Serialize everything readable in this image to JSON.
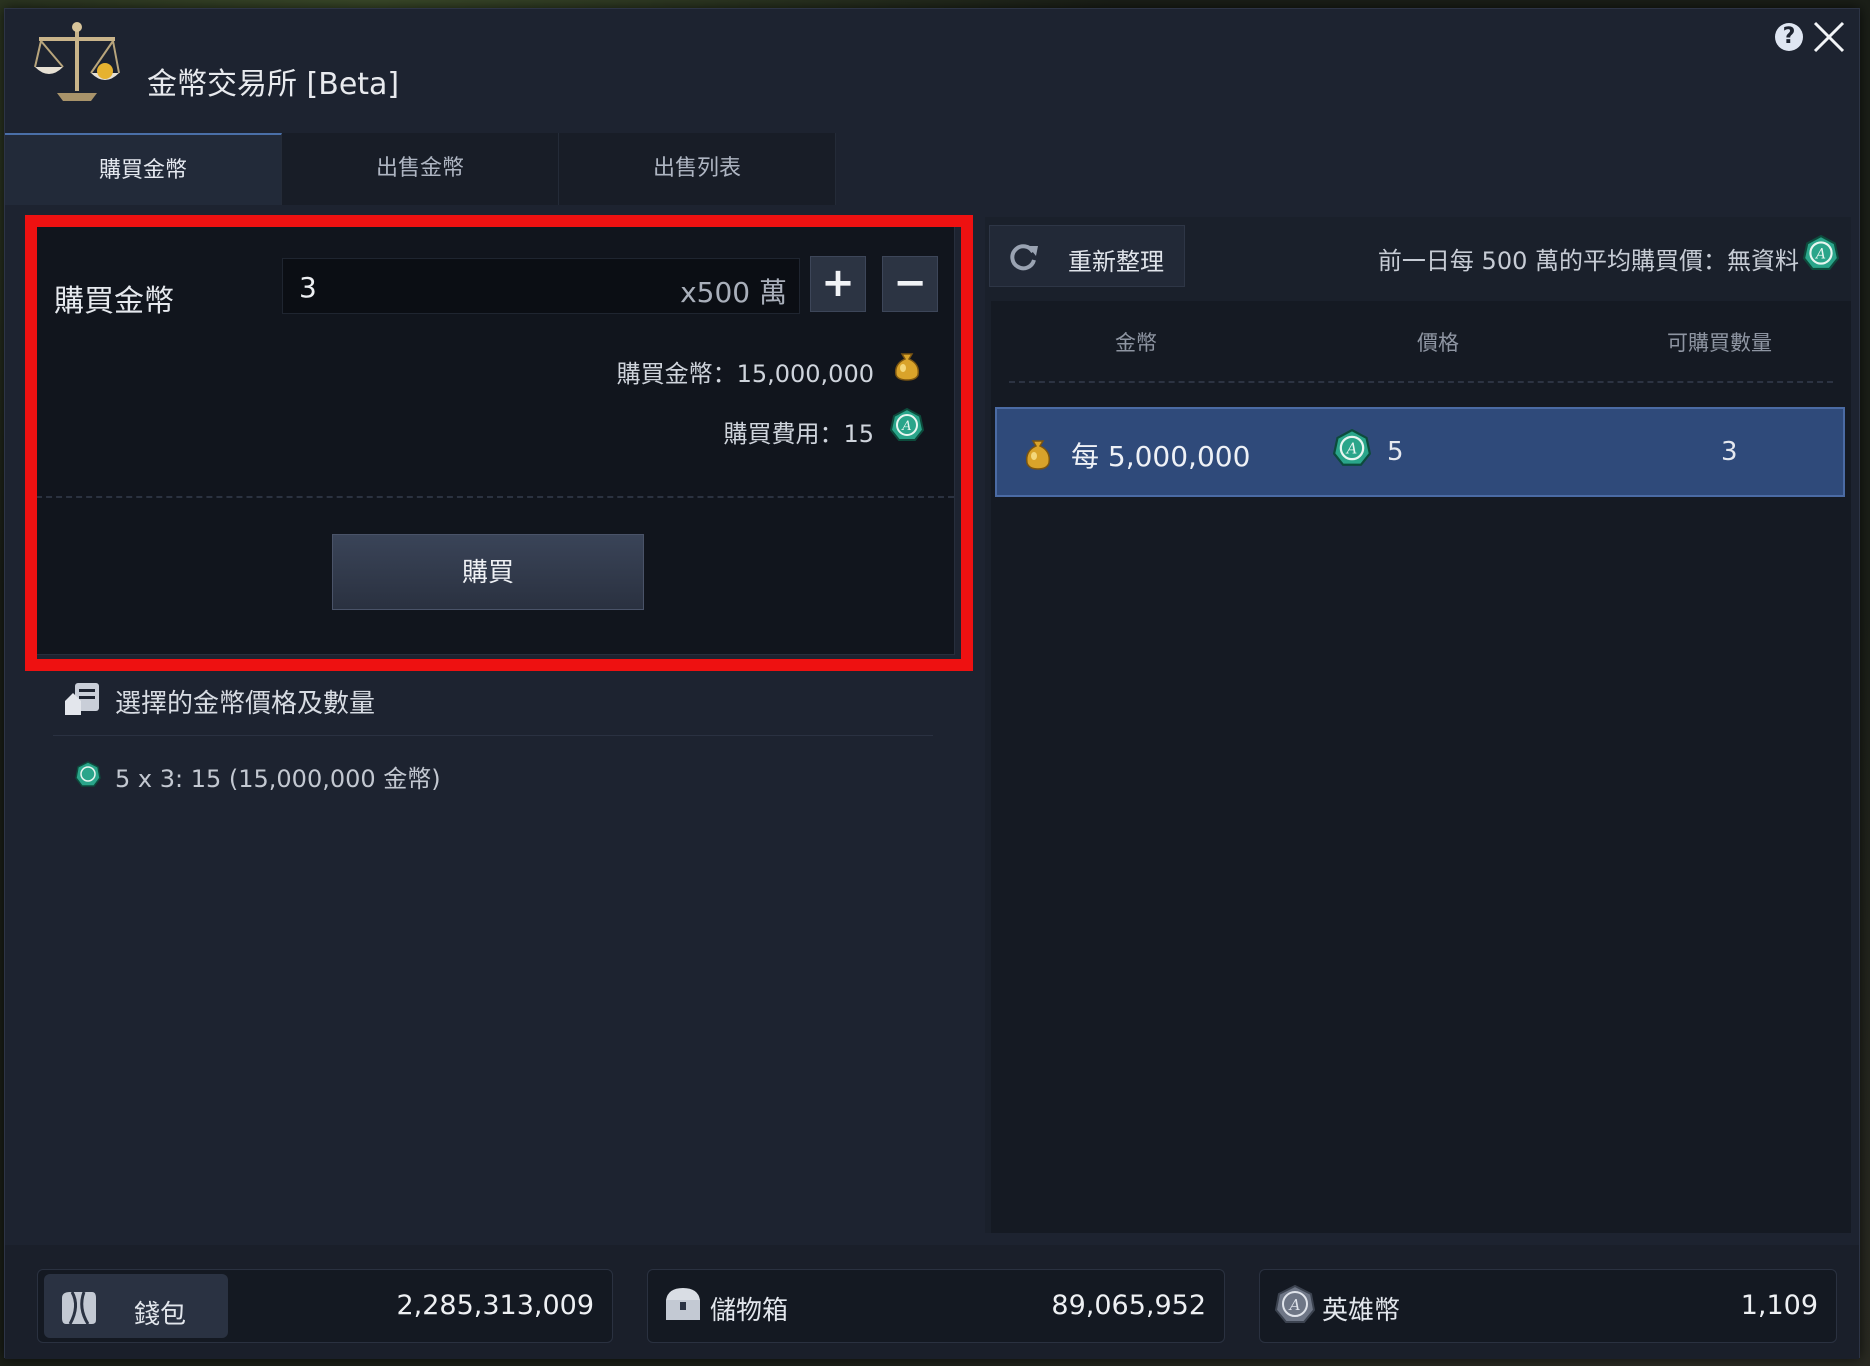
{
  "window": {
    "title": "金幣交易所 [Beta]"
  },
  "tabs": [
    {
      "label": "購買金幣",
      "active": true
    },
    {
      "label": "出售金幣",
      "active": false
    },
    {
      "label": "出售列表",
      "active": false
    }
  ],
  "buy": {
    "label": "購買金幣",
    "quantity": "3",
    "unit": "x500 萬",
    "plus": "+",
    "minus": "−",
    "gold_total": "購買金幣：15,000,000",
    "fee": "購買費用：15",
    "button": "購買"
  },
  "selection": {
    "title": "選擇的金幣價格及數量",
    "item": "5 x 3: 15 (15,000,000 金幣)"
  },
  "market": {
    "refresh": "重新整理",
    "avg_price": "前一日每 500 萬的平均購買價：無資料",
    "columns": [
      "金幣",
      "價格",
      "可購買數量"
    ],
    "rows": [
      {
        "amount": "每 5,000,000",
        "price": "5",
        "qty": "3",
        "selected": true
      }
    ]
  },
  "footer": {
    "wallet": {
      "label": "錢包",
      "value": "2,285,313,009"
    },
    "storage": {
      "label": "儲物箱",
      "value": "89,065,952"
    },
    "hero": {
      "label": "英雄幣",
      "value": "1,109"
    }
  },
  "colors": {
    "highlight": "#ee1111",
    "selected_row": "#2f4a7a",
    "hero_coin": "#2aa58a",
    "gold": "#d9a32a"
  }
}
